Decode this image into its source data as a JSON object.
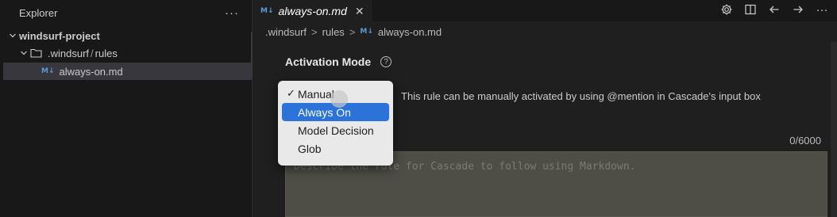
{
  "sidebar": {
    "title": "Explorer",
    "more_label": "···",
    "root": "windsurf-project",
    "folder": {
      "path_a": ".windsurf",
      "sep": "/",
      "path_b": "rules"
    },
    "file": "always-on.md"
  },
  "tab": {
    "icon": "M↓",
    "label": "always-on.md",
    "close": "✕"
  },
  "breadcrumb": {
    "part1": ".windsurf",
    "sep": ">",
    "part2": "rules",
    "icon": "M↓",
    "part3": "always-on.md"
  },
  "settings": {
    "activation_title": "Activation Mode",
    "help_icon": "?",
    "description": "This rule can be manually activated by using @mention in Cascade's input box",
    "counter": "0/6000",
    "placeholder": "Describe the rule for Cascade to follow using Markdown."
  },
  "dropdown": {
    "check": "✓",
    "options": [
      "Manual",
      "Always On",
      "Model Decision",
      "Glob"
    ],
    "checked": "Manual",
    "highlighted": "Always On"
  },
  "icons": {
    "actions": [
      "gear-icon",
      "split-editor-icon",
      "back-arrow-icon",
      "forward-arrow-icon",
      "more-icon"
    ]
  },
  "colors": {
    "highlight": "#2b73d8",
    "sidebar_bg": "#181818",
    "editor_bg": "#1f1f1f"
  }
}
